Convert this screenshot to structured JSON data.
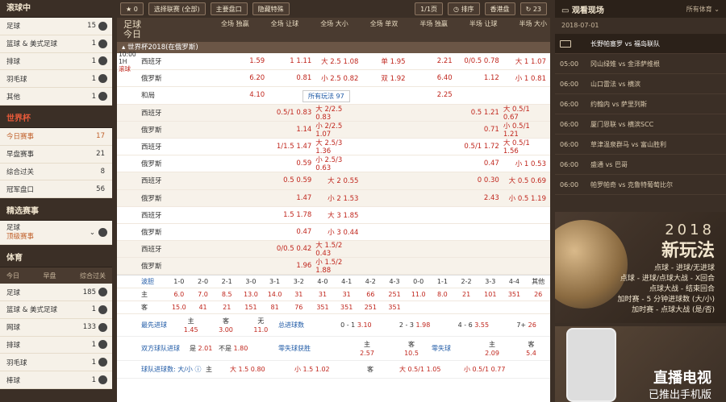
{
  "left": {
    "in_play_title": "滚球中",
    "in_play": [
      {
        "label": "足球",
        "count": "15"
      },
      {
        "label": "篮球 & 美式足球",
        "count": "1"
      },
      {
        "label": "排球",
        "count": "1"
      },
      {
        "label": "羽毛球",
        "count": "1"
      },
      {
        "label": "其他",
        "count": "1"
      }
    ],
    "wc_title": "世界杯",
    "wc": [
      {
        "label": "今日赛事",
        "count": "17"
      },
      {
        "label": "早盘赛事",
        "count": "21"
      },
      {
        "label": "综合过关",
        "count": "8"
      },
      {
        "label": "冠军盘口",
        "count": "56"
      }
    ],
    "sel_title": "精选赛事",
    "sel_sport": "足球",
    "sel_sub": "顶级赛事",
    "sports_title": "体育",
    "tabs": [
      "今日",
      "早盘",
      "综合过关"
    ],
    "sports": [
      {
        "label": "足球",
        "count": "185"
      },
      {
        "label": "篮球 & 美式足球",
        "count": "1"
      },
      {
        "label": "网球",
        "count": "133"
      },
      {
        "label": "排球",
        "count": "1"
      },
      {
        "label": "羽毛球",
        "count": "1"
      },
      {
        "label": "棒球",
        "count": "1"
      }
    ]
  },
  "toolbar": {
    "fav_count": "0",
    "select_league": "选择联赛 (全部)",
    "main_market": "主要盘口",
    "show_special": "隐藏特殊",
    "page": "1/1页",
    "sort": "排序",
    "odds_type": "香港盘",
    "refresh_count": "23"
  },
  "header": {
    "sport": "足球",
    "day": "今日",
    "cols": [
      "全场 独赢",
      "全场 让球",
      "全场 大小",
      "全场 单双",
      "半场 独赢",
      "半场 让球",
      "半场 大小"
    ]
  },
  "league": "世界杯2018(在俄罗斯)",
  "match": {
    "time": "10:00",
    "half": "1H",
    "live": "滚球",
    "more": "所有玩法 97"
  },
  "rows": [
    {
      "team": "西班牙",
      "c": [
        "1.59",
        "1  1.11",
        "大 2.5  1.08",
        "单  1.95",
        "2.21",
        "0/0.5  0.78",
        "大 1  1.07"
      ]
    },
    {
      "team": "俄罗斯",
      "c": [
        "6.20",
        "0.81",
        "小 2.5  0.82",
        "双  1.92",
        "6.40",
        "1.12",
        "小 1  0.81"
      ]
    },
    {
      "team": "和局",
      "c": [
        "4.10",
        "",
        "",
        "",
        "2.25",
        "",
        ""
      ]
    },
    {
      "team": "西班牙",
      "c": [
        "",
        "0.5/1  0.83",
        "大 2/2.5  0.83",
        "",
        "",
        "0.5  1.21",
        "大 0.5/1  0.67"
      ]
    },
    {
      "team": "俄罗斯",
      "c": [
        "",
        "1.14",
        "小 2/2.5  1.07",
        "",
        "",
        "0.71",
        "小 0.5/1  1.21"
      ]
    },
    {
      "team": "西班牙",
      "c": [
        "",
        "1/1.5  1.47",
        "大 2.5/3  1.36",
        "",
        "",
        "0.5/1  1.72",
        "大 0.5/1  1.56"
      ]
    },
    {
      "team": "俄罗斯",
      "c": [
        "",
        "0.59",
        "小 2.5/3  0.63",
        "",
        "",
        "0.47",
        "小 1  0.53"
      ]
    },
    {
      "team": "西班牙",
      "c": [
        "",
        "0.5  0.59",
        "大 2  0.55",
        "",
        "",
        "0  0.30",
        "大 0.5  0.69"
      ]
    },
    {
      "team": "俄罗斯",
      "c": [
        "",
        "1.47",
        "小 2  1.53",
        "",
        "",
        "2.43",
        "小 0.5  1.19"
      ]
    },
    {
      "team": "西班牙",
      "c": [
        "",
        "1.5  1.78",
        "大 3  1.85",
        "",
        "",
        "",
        ""
      ]
    },
    {
      "team": "俄罗斯",
      "c": [
        "",
        "0.47",
        "小 3  0.44",
        "",
        "",
        "",
        ""
      ]
    },
    {
      "team": "西班牙",
      "c": [
        "",
        "0/0.5  0.42",
        "大 1.5/2  0.43",
        "",
        "",
        "",
        ""
      ]
    },
    {
      "team": "俄罗斯",
      "c": [
        "",
        "1.96",
        "小 1.5/2  1.88",
        "",
        "",
        "",
        ""
      ]
    }
  ],
  "score": {
    "label": "波胆",
    "heads": [
      "1-0",
      "2-0",
      "2-1",
      "3-0",
      "3-1",
      "3-2",
      "4-0",
      "4-1",
      "4-2",
      "4-3",
      "0-0",
      "1-1",
      "2-2",
      "3-3",
      "4-4",
      "其他"
    ],
    "home_label": "主",
    "away_label": "客",
    "home": [
      "6.0",
      "7.0",
      "8.5",
      "13.0",
      "14.0",
      "31",
      "31",
      "31",
      "66",
      "251",
      "11.0",
      "8.0",
      "21",
      "101",
      "351",
      "26"
    ],
    "away": [
      "15.0",
      "41",
      "21",
      "151",
      "81",
      "76",
      "351",
      "351",
      "251",
      "351",
      "",
      "",
      "",
      "",
      "",
      ""
    ]
  },
  "fg": {
    "label": "最先进球",
    "h": "主",
    "a": "客",
    "n": "无",
    "hv": "1.45",
    "av": "3.00",
    "nv": "11.0",
    "tg": "总进球数",
    "tg1": "0 - 1",
    "tg1v": "3.10",
    "tg2": "2 - 3",
    "tg2v": "1.98",
    "tg3": "4 - 6",
    "tg3v": "3.55",
    "tg4": "7+",
    "tg4v": "26"
  },
  "btts": {
    "label": "双方球队进球",
    "yes": "是",
    "yv": "2.01",
    "no": "不是",
    "nv": "1.80",
    "fb": "零失球获胜",
    "fh": "主",
    "fhv": "2.57",
    "fa": "客",
    "fav": "10.5",
    "cs": "零失球",
    "ch": "主",
    "chv": "2.09",
    "ca": "客",
    "cav": "5.4"
  },
  "tg": {
    "label": "球队进球数: 大/小",
    "h": "主",
    "hv1": "大 1.5  0.80",
    "hv2": "小 1.5  1.02",
    "a": "客",
    "av1": "大 0.5/1  1.05",
    "av2": "小 0.5/1  0.77"
  },
  "right": {
    "title": "观看现场",
    "filter": "所有体育",
    "date": "2018-07-01",
    "items": [
      {
        "time": "",
        "m": "长野帕塞罗 vs 福岛联队"
      },
      {
        "time": "05:00",
        "m": "冈山绿雉 vs 金泽萨维根"
      },
      {
        "time": "06:00",
        "m": "山口雷法 vs 横滨"
      },
      {
        "time": "06:00",
        "m": "约翰内 vs 萨里列斯"
      },
      {
        "time": "06:00",
        "m": "厦门恩联 vs 横滨SCC"
      },
      {
        "time": "06:00",
        "m": "草津温泉群马 vs 富山胜利"
      },
      {
        "time": "06:00",
        "m": "盛通 vs 巴哥"
      },
      {
        "time": "06:00",
        "m": "帕罗帕奇 vs 克鲁特葡萄比尔"
      }
    ]
  },
  "ad1": {
    "year": "2018",
    "title": "新玩法",
    "l1": "点球 - 进球/无进球",
    "l2": "点球 - 进球/点球大战 - X回合",
    "l3": "点球大战 - 结束回合",
    "l4": "加时赛 - 5 分钟进球数 (大/小)",
    "l5": "加时赛 - 点球大战 (是/否)"
  },
  "ad2": {
    "t1": "直播电视",
    "t2": "已推出手机版"
  }
}
